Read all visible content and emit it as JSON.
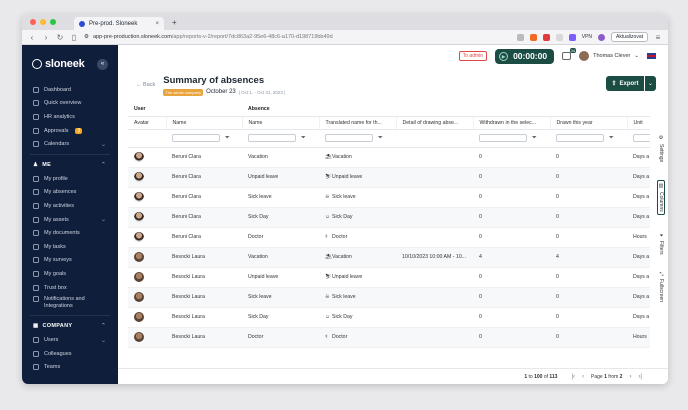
{
  "browser": {
    "tab_title": "Pre-prod. Sloneek",
    "url_main": "app-pre-production.sloneek.com",
    "url_tail": "/app/reports-v-2/report/7dc863a2-95e6-48c6-a170-d198719bb49d",
    "vpn_label": "VPN",
    "update_label": "Aktualizovat"
  },
  "sidebar": {
    "logo": "sloneek",
    "collapse_icon": "«",
    "top_items": [
      {
        "label": "Dashboard"
      },
      {
        "label": "Quick overview"
      },
      {
        "label": "HR analytics"
      },
      {
        "label": "Approvals",
        "badge": "3"
      },
      {
        "label": "Calendars"
      }
    ],
    "me_label": "ME",
    "me_items": [
      {
        "label": "My profile"
      },
      {
        "label": "My absences"
      },
      {
        "label": "My activities"
      },
      {
        "label": "My assets"
      },
      {
        "label": "My documents"
      },
      {
        "label": "My tasks"
      },
      {
        "label": "My surveys"
      },
      {
        "label": "My goals"
      },
      {
        "label": "Trust box"
      },
      {
        "label": "Notifications and Integrations"
      }
    ],
    "company_label": "COMPANY",
    "company_items": [
      {
        "label": "Users"
      },
      {
        "label": "Colleagues"
      },
      {
        "label": "Teams"
      }
    ]
  },
  "topbar": {
    "admin_tag": "To admin",
    "timer": "00:00:00",
    "messages_count": "34",
    "user_name": "Thomas Clever"
  },
  "page": {
    "back_label": "Back",
    "title": "Summary of absences",
    "period_tag": "The whole company",
    "month": "October 23",
    "range": "| Oct 1. - Oct 31, 2023 |",
    "export_label": "Export"
  },
  "table": {
    "group_headers": [
      "User",
      "Absence"
    ],
    "columns": [
      "Avatar",
      "Name",
      "Name",
      "Translated name for th...",
      "Detail of drawing abse...",
      "Withdrawn in the selec...",
      "Drawn this year",
      "Unit"
    ],
    "rows": [
      {
        "avatar": "a",
        "user": "Beruni Clara",
        "absence": "Vacation",
        "icon": "⛱",
        "translated": "Vacation",
        "detail": "",
        "withdrawn": "0",
        "drawn": "0",
        "unit": "Days a"
      },
      {
        "avatar": "a",
        "user": "Beruni Clara",
        "absence": "Unpaid leave",
        "icon": "⛷",
        "translated": "Unpaid leave",
        "detail": "",
        "withdrawn": "0",
        "drawn": "0",
        "unit": "Days a"
      },
      {
        "avatar": "a",
        "user": "Beruni Clara",
        "absence": "Sick leave",
        "icon": "☠",
        "translated": "Sick leave",
        "detail": "",
        "withdrawn": "0",
        "drawn": "0",
        "unit": "Days a"
      },
      {
        "avatar": "a",
        "user": "Beruni Clara",
        "absence": "Sick Day",
        "icon": "☺",
        "translated": "Sick Day",
        "detail": "",
        "withdrawn": "0",
        "drawn": "0",
        "unit": "Days a"
      },
      {
        "avatar": "a",
        "user": "Beruni Clara",
        "absence": "Doctor",
        "icon": "⚕",
        "translated": "Doctor",
        "detail": "",
        "withdrawn": "0",
        "drawn": "0",
        "unit": "Hours"
      },
      {
        "avatar": "b",
        "user": "Besocki Laura",
        "absence": "Vacation",
        "icon": "⛱",
        "translated": "Vacation",
        "detail": "10/10/2023 10:00 AM - 10...",
        "withdrawn": "4",
        "drawn": "4",
        "unit": "Days a"
      },
      {
        "avatar": "b",
        "user": "Besocki Laura",
        "absence": "Unpaid leave",
        "icon": "⛷",
        "translated": "Unpaid leave",
        "detail": "",
        "withdrawn": "0",
        "drawn": "0",
        "unit": "Days a"
      },
      {
        "avatar": "b",
        "user": "Besocki Laura",
        "absence": "Sick leave",
        "icon": "☠",
        "translated": "Sick leave",
        "detail": "",
        "withdrawn": "0",
        "drawn": "0",
        "unit": "Days a"
      },
      {
        "avatar": "b",
        "user": "Besocki Laura",
        "absence": "Sick Day",
        "icon": "☺",
        "translated": "Sick Day",
        "detail": "",
        "withdrawn": "0",
        "drawn": "0",
        "unit": "Days a"
      },
      {
        "avatar": "b",
        "user": "Besocki Laura",
        "absence": "Doctor",
        "icon": "⚕",
        "translated": "Doctor",
        "detail": "",
        "withdrawn": "0",
        "drawn": "0",
        "unit": "Hours"
      }
    ]
  },
  "right_rail": [
    "Settings",
    "Columns",
    "Filters",
    "Fullscreen"
  ],
  "footer": {
    "range_from": "1",
    "range_to": "100",
    "range_word_to": "to",
    "range_word_of": "of",
    "total": "113",
    "page_word": "Page",
    "page_current": "1",
    "page_from_word": "from",
    "page_total": "2"
  }
}
